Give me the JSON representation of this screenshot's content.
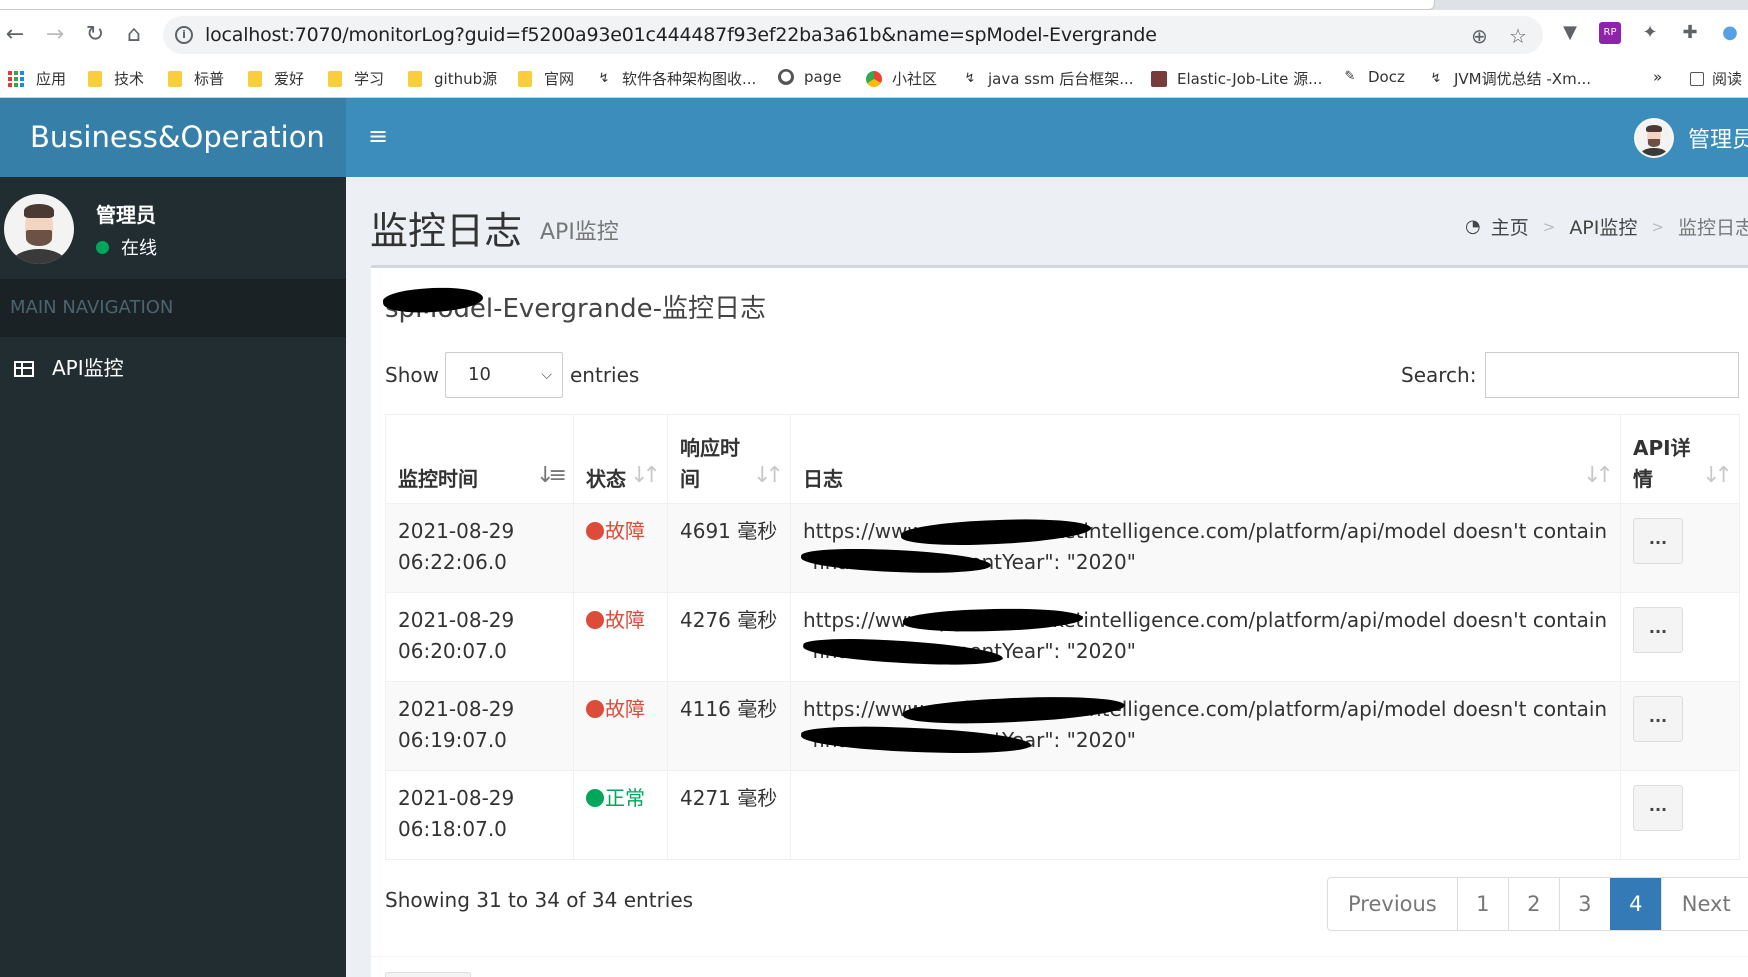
{
  "browser": {
    "url": "localhost:7070/monitorLog?guid=f5200a93e01c444487f93ef22ba3a61b&name=spModel-Evergrande",
    "bookmarks": [
      {
        "label": "应用",
        "icon": "apps-grid-icon"
      },
      {
        "label": "技术",
        "icon": "folder-icon"
      },
      {
        "label": "标普",
        "icon": "folder-icon"
      },
      {
        "label": "爱好",
        "icon": "folder-icon"
      },
      {
        "label": "学习",
        "icon": "folder-icon"
      },
      {
        "label": "github源",
        "icon": "folder-icon"
      },
      {
        "label": "官网",
        "icon": "folder-icon"
      },
      {
        "label": "软件各种架构图收...",
        "icon": "page-icon"
      },
      {
        "label": "page",
        "icon": "globe-icon"
      },
      {
        "label": "小社区",
        "icon": "chrome-icon"
      },
      {
        "label": "java ssm 后台框架...",
        "icon": "page-icon"
      },
      {
        "label": "Elastic-Job-Lite 源...",
        "icon": "page-icon"
      },
      {
        "label": "Docz",
        "icon": "page-icon"
      },
      {
        "label": "JVM调优总结 -Xm...",
        "icon": "page-icon"
      },
      {
        "label": "»",
        "icon": "more-icon"
      },
      {
        "label": "阅读",
        "icon": "reading-list-icon"
      }
    ]
  },
  "header": {
    "logo": "Business&Operation",
    "user_name": "管理员"
  },
  "sidebar": {
    "user_name": "管理员",
    "status": "在线",
    "nav_header": "MAIN NAVIGATION",
    "items": [
      {
        "label": "API监控",
        "icon": "table-icon"
      }
    ]
  },
  "content": {
    "title": "监控日志",
    "subtitle": "API监控",
    "breadcrumb": [
      "主页",
      "API监控",
      "监控日志"
    ]
  },
  "box": {
    "title": "spModel-Evergrande-监控日志",
    "show_label": "Show",
    "entries_label": "entries",
    "page_length": "10",
    "search_label": "Search:",
    "search_value": "",
    "columns": [
      "监控时间",
      "状态",
      "响应时间",
      "日志",
      "API详情"
    ],
    "rows": [
      {
        "time": "2021-08-29 06:22:06.0",
        "status": "故障",
        "status_color": "#dd4b39",
        "response": "4691 毫秒",
        "log": "https://www.spglobalmarketintelligence.com/platform/api/model doesn't contain \"financialStatementYear\": \"2020\"",
        "detail": "..."
      },
      {
        "time": "2021-08-29 06:20:07.0",
        "status": "故障",
        "status_color": "#dd4b39",
        "response": "4276 毫秒",
        "log": "https://www.spglobalmarketintelligence.com/platform/api/model doesn't contain \"financialStatementYear\": \"2020\"",
        "detail": "..."
      },
      {
        "time": "2021-08-29 06:19:07.0",
        "status": "故障",
        "status_color": "#dd4b39",
        "response": "4116 毫秒",
        "log": "https://www.spglobalmarketintelligence.com/platform/api/model doesn't contain \"financialStatementYear\": \"2020\"",
        "detail": "..."
      },
      {
        "time": "2021-08-29 06:18:07.0",
        "status": "正常",
        "status_color": "#00a65a",
        "response": "4271 毫秒",
        "log": "",
        "detail": "..."
      }
    ],
    "info": "Showing 31 to 34 of 34 entries",
    "pagination": {
      "previous": "Previous",
      "pages": [
        "1",
        "2",
        "3",
        "4"
      ],
      "active": "4",
      "next": "Next"
    }
  },
  "colors": {
    "header_blue": "#3c8dbc",
    "logo_blue": "#367fa9",
    "sidebar_dark": "#222d32",
    "danger": "#dd4b39",
    "success": "#00a65a",
    "pagination_active": "#337ab7"
  }
}
